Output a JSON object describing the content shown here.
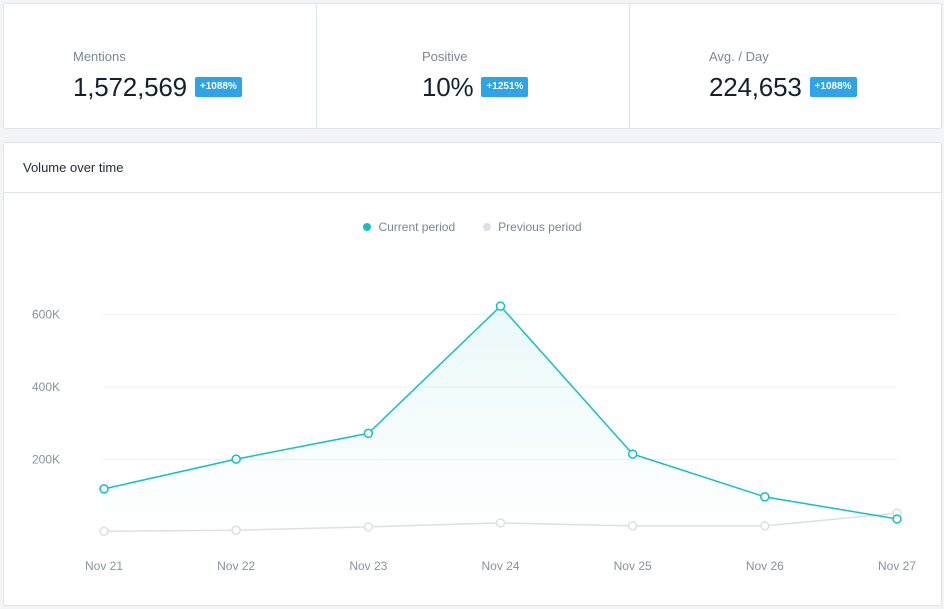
{
  "stats": [
    {
      "label": "Mentions",
      "value": "1,572,569",
      "change": "+1088%"
    },
    {
      "label": "Positive",
      "value": "10%",
      "change": "+1251%"
    },
    {
      "label": "Avg. / Day",
      "value": "224,653",
      "change": "+1088%"
    }
  ],
  "colors": {
    "accent": "#17bec3",
    "previous": "#dcdfe6",
    "badge": "#2ea3e8"
  },
  "panel": {
    "title": "Volume over time"
  },
  "chart_data": {
    "type": "line",
    "title": "Volume over time",
    "xlabel": "",
    "ylabel": "",
    "categories": [
      "Nov 21",
      "Nov 22",
      "Nov 23",
      "Nov 24",
      "Nov 25",
      "Nov 26",
      "Nov 27"
    ],
    "series": [
      {
        "name": "Current period",
        "values": [
          119000,
          201000,
          272000,
          623000,
          215000,
          97000,
          36000
        ],
        "area": true
      },
      {
        "name": "Previous period",
        "values": [
          2000,
          5000,
          14000,
          25000,
          17000,
          17000,
          52000
        ],
        "area": false
      }
    ],
    "yticks": [
      200000,
      400000,
      600000
    ],
    "ytick_labels": [
      "200K",
      "400K",
      "600K"
    ],
    "ylim": [
      0,
      650000
    ],
    "grid": true,
    "legend": "top-center"
  }
}
